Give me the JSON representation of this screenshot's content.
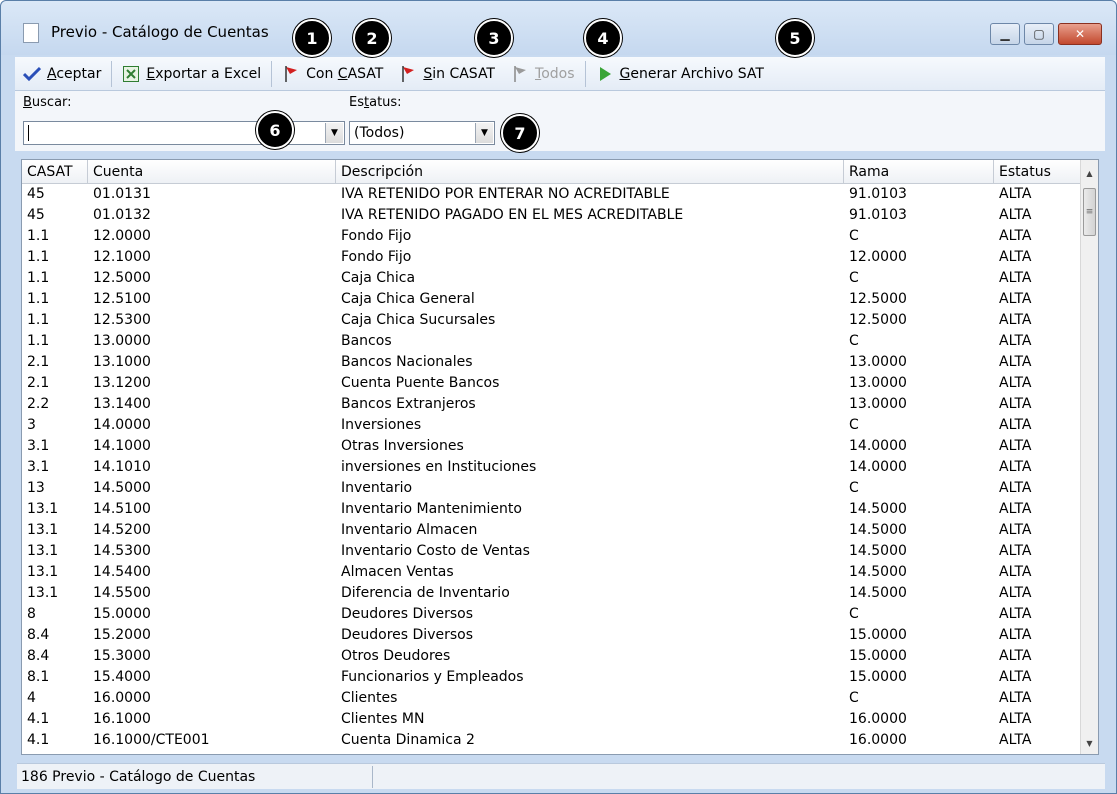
{
  "window": {
    "title": "Previo - Catálogo de Cuentas",
    "buttons": {
      "minimize": "▁",
      "maximize": "▢",
      "close": "✕"
    }
  },
  "toolbar": {
    "aceptar": {
      "label": "Aceptar",
      "underline": "A",
      "rest": "ceptar",
      "icon": "checkmark-icon"
    },
    "excel": {
      "label": "Exportar a Excel",
      "underline": "E",
      "rest": "xportar a Excel",
      "icon": "excel-icon"
    },
    "con_casat": {
      "label": "Con CASAT",
      "pre": "Con ",
      "underline": "C",
      "rest": "ASAT",
      "icon": "red-flag-icon"
    },
    "sin_casat": {
      "label": "Sin CASAT",
      "underline": "S",
      "rest": "in CASAT",
      "icon": "red-flag-icon"
    },
    "todos": {
      "label": "Todos",
      "underline": "T",
      "rest": "odos",
      "icon": "gray-flag-icon",
      "disabled": true
    },
    "generar": {
      "label": "Generar Archivo SAT",
      "underline": "G",
      "rest": "enerar Archivo SAT",
      "icon": "play-arrow-icon"
    }
  },
  "filters": {
    "buscar_label": "Buscar:",
    "buscar_value": "",
    "estatus_label": "Estatus:",
    "estatus_value": "(Todos)"
  },
  "badges": [
    "1",
    "2",
    "3",
    "4",
    "5",
    "6",
    "7"
  ],
  "table": {
    "columns": [
      "CASAT",
      "Cuenta",
      "Descripción",
      "Rama",
      "Estatus"
    ],
    "rows": [
      [
        "45",
        "01.0131",
        "IVA RETENIDO POR ENTERAR NO ACREDITABLE",
        "91.0103",
        "ALTA"
      ],
      [
        "45",
        "01.0132",
        "IVA RETENIDO PAGADO EN EL MES ACREDITABLE",
        "91.0103",
        "ALTA"
      ],
      [
        "1.1",
        "12.0000",
        "Fondo Fijo",
        "C",
        "ALTA"
      ],
      [
        "1.1",
        "12.1000",
        "Fondo Fijo",
        "12.0000",
        "ALTA"
      ],
      [
        "1.1",
        "12.5000",
        "Caja Chica",
        "C",
        "ALTA"
      ],
      [
        "1.1",
        "12.5100",
        "Caja Chica General",
        "12.5000",
        "ALTA"
      ],
      [
        "1.1",
        "12.5300",
        "Caja Chica Sucursales",
        "12.5000",
        "ALTA"
      ],
      [
        "1.1",
        "13.0000",
        "Bancos",
        "C",
        "ALTA"
      ],
      [
        "2.1",
        "13.1000",
        "Bancos Nacionales",
        "13.0000",
        "ALTA"
      ],
      [
        "2.1",
        "13.1200",
        "Cuenta Puente Bancos",
        "13.0000",
        "ALTA"
      ],
      [
        "2.2",
        "13.1400",
        "Bancos Extranjeros",
        "13.0000",
        "ALTA"
      ],
      [
        "3",
        "14.0000",
        "Inversiones",
        "C",
        "ALTA"
      ],
      [
        "3.1",
        "14.1000",
        "Otras Inversiones",
        "14.0000",
        "ALTA"
      ],
      [
        "3.1",
        "14.1010",
        "inversiones en Instituciones",
        "14.0000",
        "ALTA"
      ],
      [
        "13",
        "14.5000",
        "Inventario",
        "C",
        "ALTA"
      ],
      [
        "13.1",
        "14.5100",
        "Inventario Mantenimiento",
        "14.5000",
        "ALTA"
      ],
      [
        "13.1",
        "14.5200",
        "Inventario Almacen",
        "14.5000",
        "ALTA"
      ],
      [
        "13.1",
        "14.5300",
        "Inventario Costo de Ventas",
        "14.5000",
        "ALTA"
      ],
      [
        "13.1",
        "14.5400",
        "Almacen Ventas",
        "14.5000",
        "ALTA"
      ],
      [
        "13.1",
        "14.5500",
        "Diferencia de Inventario",
        "14.5000",
        "ALTA"
      ],
      [
        "8",
        "15.0000",
        "Deudores Diversos",
        "C",
        "ALTA"
      ],
      [
        "8.4",
        "15.2000",
        "Deudores Diversos",
        "15.0000",
        "ALTA"
      ],
      [
        "8.4",
        "15.3000",
        "Otros Deudores",
        "15.0000",
        "ALTA"
      ],
      [
        "8.1",
        "15.4000",
        "Funcionarios y Empleados",
        "15.0000",
        "ALTA"
      ],
      [
        "4",
        "16.0000",
        "Clientes",
        "C",
        "ALTA"
      ],
      [
        "4.1",
        "16.1000",
        "Clientes MN",
        "16.0000",
        "ALTA"
      ],
      [
        "4.1",
        "16.1000/CTE001",
        "Cuenta Dinamica 2",
        "16.0000",
        "ALTA"
      ]
    ]
  },
  "status": {
    "text": "186 Previo - Catálogo de Cuentas",
    "second": ""
  },
  "scrollbar": {
    "up": "▲",
    "down": "▼",
    "thumb": "≡"
  }
}
